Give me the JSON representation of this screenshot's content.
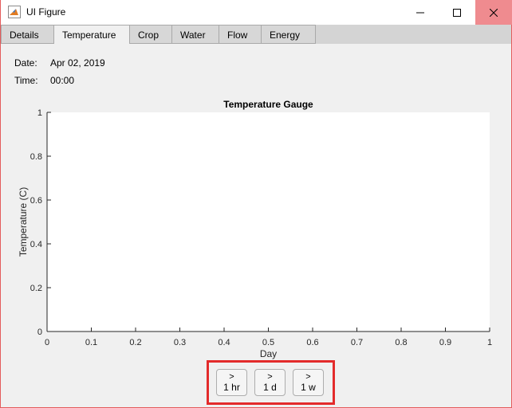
{
  "window": {
    "title": "UI Figure"
  },
  "tabs": [
    {
      "label": "Details",
      "active": false
    },
    {
      "label": "Temperature",
      "active": true
    },
    {
      "label": "Crop",
      "active": false
    },
    {
      "label": "Water",
      "active": false
    },
    {
      "label": "Flow",
      "active": false
    },
    {
      "label": "Energy",
      "active": false
    }
  ],
  "info": {
    "date_label": "Date:",
    "date_value": "Apr 02, 2019",
    "time_label": "Time:",
    "time_value": "00:00"
  },
  "chart_data": {
    "type": "line",
    "title": "Temperature Gauge",
    "xlabel": "Day",
    "ylabel": "Temperature (C)",
    "xlim": [
      0,
      1
    ],
    "ylim": [
      0,
      1
    ],
    "xticks": [
      "0",
      "0.1",
      "0.2",
      "0.3",
      "0.4",
      "0.5",
      "0.6",
      "0.7",
      "0.8",
      "0.9",
      "1"
    ],
    "yticks": [
      "0",
      "0.2",
      "0.4",
      "0.6",
      "0.8",
      "1"
    ],
    "grid": false,
    "series": []
  },
  "controls": {
    "buttons": [
      {
        "arrow": ">",
        "label": "1 hr"
      },
      {
        "arrow": ">",
        "label": "1 d"
      },
      {
        "arrow": ">",
        "label": "1 w"
      }
    ]
  },
  "colors": {
    "accent_highlight": "#e32b2b",
    "close_button": "#ef8b8f",
    "plot_bg": "#ffffff"
  }
}
